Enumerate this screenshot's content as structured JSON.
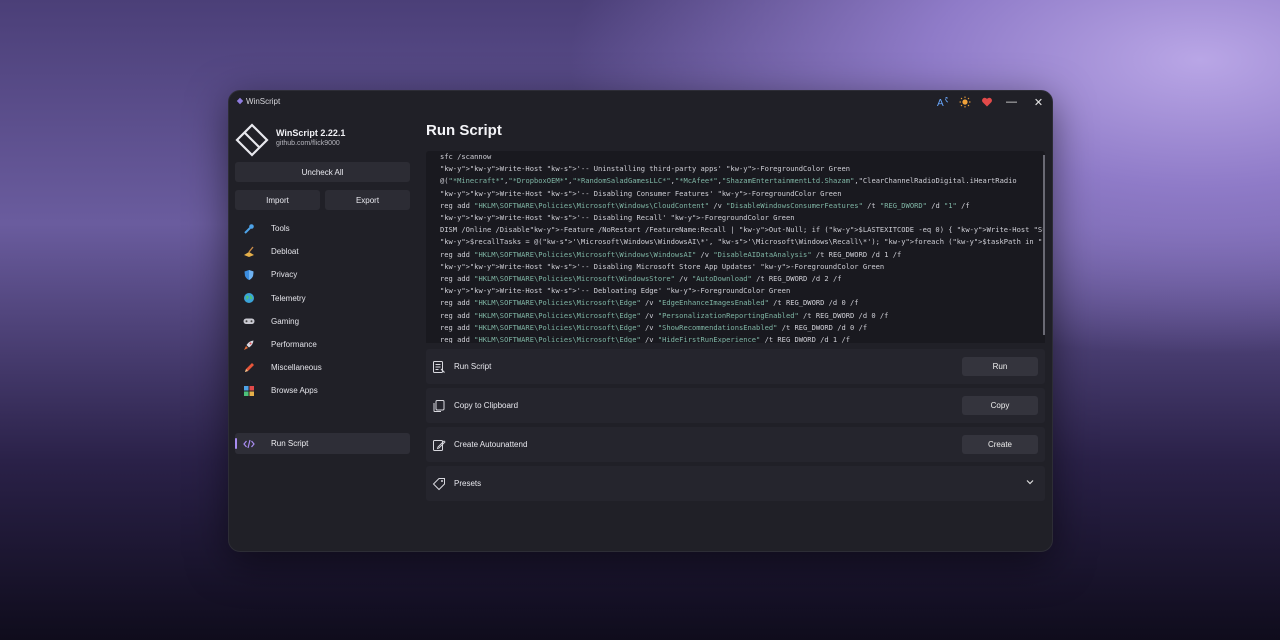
{
  "window": {
    "title": "WinScript"
  },
  "titlebar": {
    "minimize": "—",
    "close": "✕"
  },
  "brand": {
    "title": "WinScript 2.22.1",
    "subtitle": "github.com/flick9000"
  },
  "sidebar": {
    "uncheck_all": "Uncheck All",
    "import": "Import",
    "export": "Export",
    "items": [
      {
        "label": "Tools",
        "icon": "wrench-icon"
      },
      {
        "label": "Debloat",
        "icon": "broom-icon"
      },
      {
        "label": "Privacy",
        "icon": "shield-icon"
      },
      {
        "label": "Telemetry",
        "icon": "globe-icon"
      },
      {
        "label": "Gaming",
        "icon": "gamepad-icon"
      },
      {
        "label": "Performance",
        "icon": "rocket-icon"
      },
      {
        "label": "Miscellaneous",
        "icon": "pencil-icon"
      },
      {
        "label": "Browse Apps",
        "icon": "apps-icon"
      }
    ],
    "active": {
      "label": "Run Script",
      "icon": "code-icon"
    }
  },
  "main": {
    "title": "Run Script",
    "script_lines": [
      "sfc /scannow",
      "Write-Host '-- Uninstalling third-party apps' -ForegroundColor Green",
      "@(\"*Minecraft*\",\"*DropboxOEM*\",\"*RandomSaladGamesLLC*\",\"*McAfee*\",\"ShazamEntertainmentLtd.Shazam\",\"ClearChannelRadioDigital.iHeartRadio",
      "Write-Host '-- Disabling Consumer Features' -ForegroundColor Green",
      "reg add \"HKLM\\SOFTWARE\\Policies\\Microsoft\\Windows\\CloudContent\" /v \"DisableWindowsConsumerFeatures\" /t \"REG_DWORD\" /d \"1\" /f",
      "Write-Host '-- Disabling Recall' -ForegroundColor Green",
      "DISM /Online /Disable-Feature /NoRestart /FeatureName:Recall | Out-Null; if ($LASTEXITCODE -eq 0) { Write-Host \"Successfully removed th",
      "$recallTasks = @('\\Microsoft\\Windows\\WindowsAI\\*', '\\Microsoft\\Windows\\Recall\\*'); foreach ($taskPath in $recallTasks) { try { $tasks =",
      "reg add \"HKLM\\SOFTWARE\\Policies\\Microsoft\\Windows\\WindowsAI\" /v \"DisableAIDataAnalysis\" /t REG_DWORD /d 1 /f",
      "Write-Host '-- Disabling Microsoft Store App Updates' -ForegroundColor Green",
      "reg add \"HKLM\\SOFTWARE\\Policies\\Microsoft\\WindowsStore\" /v \"AutoDownload\" /t REG_DWORD /d 2 /f",
      "Write-Host '-- Debloating Edge' -ForegroundColor Green",
      "reg add \"HKLM\\SOFTWARE\\Policies\\Microsoft\\Edge\" /v \"EdgeEnhanceImagesEnabled\" /t REG_DWORD /d 0 /f",
      "reg add \"HKLM\\SOFTWARE\\Policies\\Microsoft\\Edge\" /v \"PersonalizationReportingEnabled\" /t REG_DWORD /d 0 /f",
      "reg add \"HKLM\\SOFTWARE\\Policies\\Microsoft\\Edge\" /v \"ShowRecommendationsEnabled\" /t REG_DWORD /d 0 /f",
      "reg add \"HKLM\\SOFTWARE\\Policies\\Microsoft\\Edge\" /v \"HideFirstRunExperience\" /t REG_DWORD /d 1 /f"
    ],
    "actions": [
      {
        "label": "Run Script",
        "button": "Run",
        "icon": "script-icon"
      },
      {
        "label": "Copy to Clipboard",
        "button": "Copy",
        "icon": "copy-icon"
      },
      {
        "label": "Create Autounattend",
        "button": "Create",
        "icon": "document-edit-icon"
      }
    ],
    "presets": {
      "label": "Presets",
      "icon": "tag-icon"
    }
  },
  "colors": {
    "accent": "#a88cf0",
    "window_bg": "#202027",
    "code_bg": "#19191f"
  }
}
